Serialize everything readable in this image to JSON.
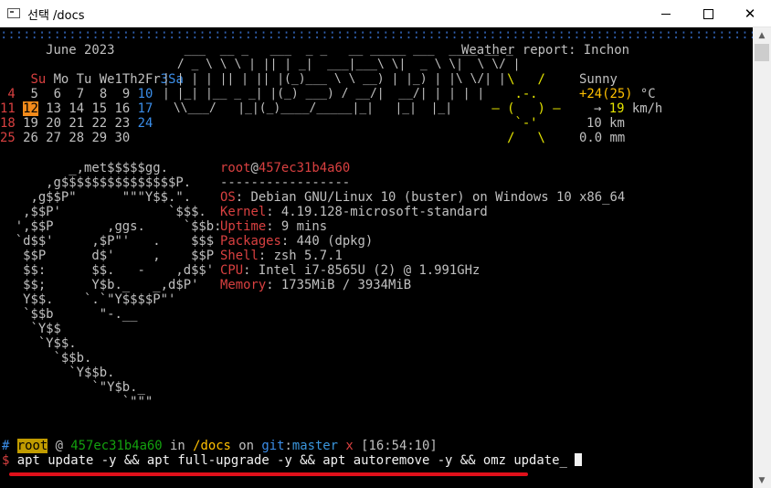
{
  "window": {
    "title": "선택 /docs",
    "minimize_label": "–",
    "maximize_label": "□",
    "close_label": "✕",
    "app_icon": "console-icon"
  },
  "colors": {
    "red": "#d94040",
    "blue": "#3b8eea",
    "green": "#13a10e",
    "yellow": "#e5e500",
    "orange": "#ffc000",
    "highlight": "#f28b1b",
    "annotation_underline": "#e0101a"
  },
  "banner_dots": "::::::::::::::::::::::::::::::::::::::::::::::::::::::::::::::::::::::::::::::::::::::::::::::::::::::::::::::",
  "calendar": {
    "header": "      June 2023",
    "weekdays": [
      "Su",
      "Mo",
      "Tu",
      "We",
      "Th",
      "Fr",
      "Sa"
    ],
    "weeks": [
      [
        "",
        "",
        "",
        "",
        "1",
        "2",
        "3"
      ],
      [
        "4",
        "5",
        "6",
        "7",
        "8",
        "9",
        "10"
      ],
      [
        "11",
        "12",
        "13",
        "14",
        "15",
        "16",
        "17"
      ],
      [
        "18",
        "19",
        "20",
        "21",
        "22",
        "23",
        "24"
      ],
      [
        "25",
        "26",
        "27",
        "28",
        "29",
        "30",
        ""
      ]
    ],
    "today": "12"
  },
  "ascii_title": [
    "  ___  __ _   ___  _ _   __ _____ ___  ____ __ _ ",
    " / _ \\ \\ \\ | || | _|  ___|___\\ \\|  _ \\ \\|  \\ \\/ |",
    "| | | | || | || |(_)___ \\ \\ __) | |_) | |\\ \\/| |",
    "| |_| |__ _ _| |(_) ___) / __/|  __/| | | | |",
    " \\\\___/   |_|(_)____/_____|_|   |_|  |_| "
  ],
  "weather": {
    "heading": "Weather report: Inchon",
    "art": [
      "   \\   /     ",
      "    .-.      ",
      " ― (   ) ―   ",
      "    `-'      ",
      "   /   \\     "
    ],
    "condition": "Sunny",
    "temp_main": "+24",
    "temp_feels": "(25)",
    "temp_unit": " °C",
    "wind_arrow": "→",
    "wind_speed": "19",
    "wind_unit": " km/h",
    "visibility": "10 km",
    "precip": "0.0 mm"
  },
  "logo": [
    "         _,met$$$$$gg.",
    "      ,g$$$$$$$$$$$$$$$P.",
    "    ,g$$P\"      \"\"\"Y$$.\".  ",
    "   ,$$P'              `$$$.",
    "  ',$$P       ,ggs.     `$$b:",
    "  `d$$'     ,$P\"'   .    $$$",
    "   $$P      d$'     ,    $$P",
    "   $$:      $$.   -    ,d$$'",
    "   $$;      Y$b._   _,d$P'",
    "   Y$$.    `.`\"Y$$$$P\"'",
    "   `$$b      \"-.__",
    "    `Y$$",
    "     `Y$$.",
    "       `$$b.",
    "         `Y$$b.",
    "            `\"Y$b._",
    "                `\"\"\""
  ],
  "sysinfo": {
    "user": "root",
    "at": "@",
    "host": "457ec31b4a60",
    "separator": "-----------------",
    "rows": [
      {
        "key": "OS",
        "value": "Debian GNU/Linux 10 (buster) on Windows 10 x86_64"
      },
      {
        "key": "Kernel",
        "value": "4.19.128-microsoft-standard"
      },
      {
        "key": "Uptime",
        "value": "9 mins"
      },
      {
        "key": "Packages",
        "value": "440 (dpkg)"
      },
      {
        "key": "Shell",
        "value": "zsh 5.7.1"
      },
      {
        "key": "CPU",
        "value": "Intel i7-8565U (2) @ 1.991GHz"
      },
      {
        "key": "Memory",
        "value": "1735MiB / 3934MiB"
      }
    ]
  },
  "prompt": {
    "hash": "#",
    "user": "root",
    "at": " @ ",
    "host": "457ec31b4a60",
    "in": " in ",
    "dir": "/docs",
    "on": " on ",
    "git_label": "git",
    "git_sep": ":",
    "branch": "master",
    "dirty": " x",
    "time": " [16:54:10]",
    "symbol": "$",
    "command": " apt update -y && apt full-upgrade -y && apt autoremove -y && omz update"
  }
}
